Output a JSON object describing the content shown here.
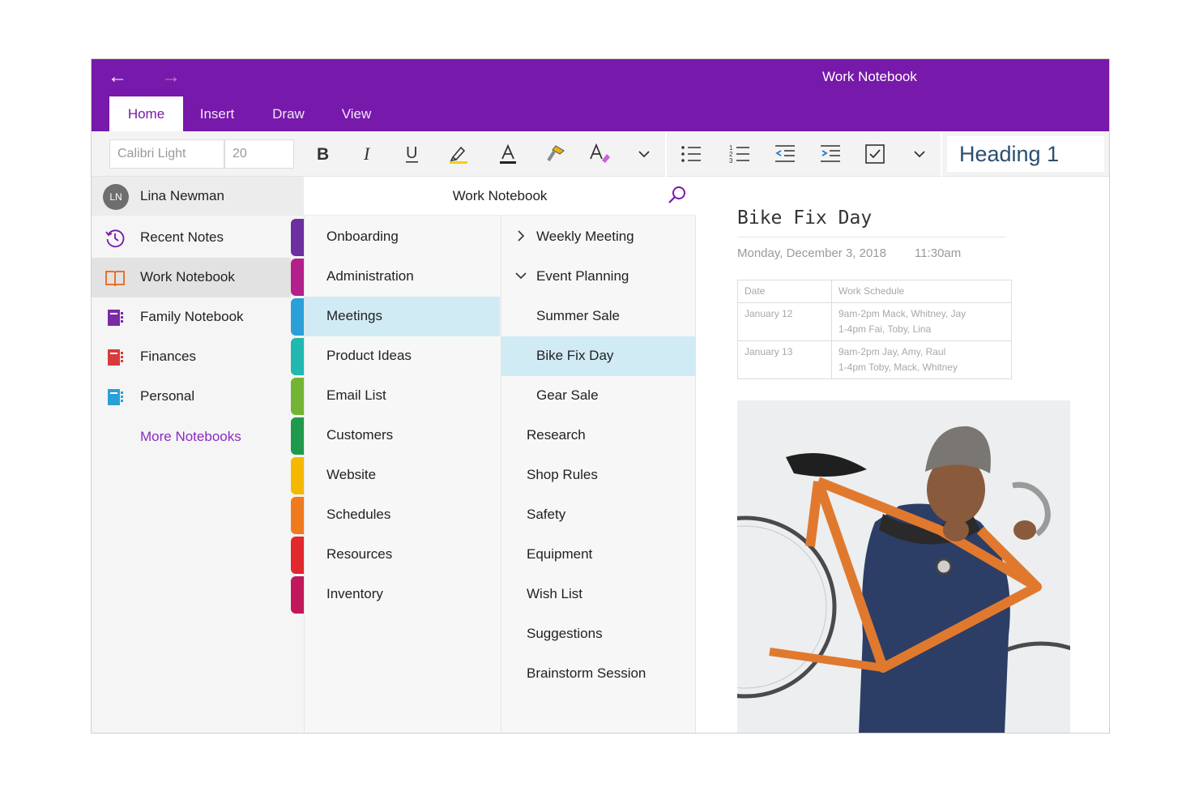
{
  "window": {
    "title": "Work Notebook"
  },
  "tabs": [
    {
      "label": "Home",
      "active": true
    },
    {
      "label": "Insert",
      "active": false
    },
    {
      "label": "Draw",
      "active": false
    },
    {
      "label": "View",
      "active": false
    }
  ],
  "ribbon": {
    "font_name": "Calibri Light",
    "font_size": "20",
    "style": "Heading 1",
    "buttons": [
      "bold-icon",
      "italic-icon",
      "underline-icon",
      "highlighter-icon",
      "font-color-icon",
      "format-painter-icon",
      "text-styles-icon",
      "chevron-down-icon",
      "bullet-list-icon",
      "numbered-list-icon",
      "outdent-icon",
      "indent-icon",
      "checkbox-icon",
      "chevron-down-icon"
    ]
  },
  "user": {
    "initials": "LN",
    "name": "Lina Newman"
  },
  "notebooks": [
    {
      "label": "Recent Notes",
      "icon": "clock-icon",
      "color": "#7719aa",
      "active": false
    },
    {
      "label": "Work Notebook",
      "icon": "book-open-icon",
      "color": "#e8722a",
      "active": true
    },
    {
      "label": "Family Notebook",
      "icon": "notebook-icon",
      "color": "#7b2ba6",
      "active": false
    },
    {
      "label": "Finances",
      "icon": "notebook-icon",
      "color": "#d83b3b",
      "active": false
    },
    {
      "label": "Personal",
      "icon": "notebook-icon",
      "color": "#2aa0d8",
      "active": false
    }
  ],
  "more_notebooks": "More Notebooks",
  "notebook_header": "Work Notebook",
  "sections": [
    {
      "label": "Onboarding",
      "color": "#6b2fa0",
      "active": false
    },
    {
      "label": "Administration",
      "color": "#b3208c",
      "active": false
    },
    {
      "label": "Meetings",
      "color": "#2a9fd8",
      "active": true
    },
    {
      "label": "Product Ideas",
      "color": "#21b8b0",
      "active": false
    },
    {
      "label": "Email List",
      "color": "#73b532",
      "active": false
    },
    {
      "label": "Customers",
      "color": "#1f9a4c",
      "active": false
    },
    {
      "label": "Website",
      "color": "#f5b800",
      "active": false
    },
    {
      "label": "Schedules",
      "color": "#f07a1e",
      "active": false
    },
    {
      "label": "Resources",
      "color": "#e0282d",
      "active": false
    },
    {
      "label": "Inventory",
      "color": "#c2185b",
      "active": false
    }
  ],
  "pages": [
    {
      "label": "Weekly Meeting",
      "level": 0,
      "chevron": "right",
      "active": false
    },
    {
      "label": "Event Planning",
      "level": 0,
      "chevron": "down",
      "active": false
    },
    {
      "label": "Summer Sale",
      "level": 1,
      "chevron": "",
      "active": false
    },
    {
      "label": "Bike Fix Day",
      "level": 1,
      "chevron": "",
      "active": true
    },
    {
      "label": "Gear Sale",
      "level": 1,
      "chevron": "",
      "active": false
    },
    {
      "label": "Research",
      "level": 0,
      "chevron": "",
      "active": false
    },
    {
      "label": "Shop Rules",
      "level": 0,
      "chevron": "",
      "active": false
    },
    {
      "label": "Safety",
      "level": 0,
      "chevron": "",
      "active": false
    },
    {
      "label": "Equipment",
      "level": 0,
      "chevron": "",
      "active": false
    },
    {
      "label": "Wish List",
      "level": 0,
      "chevron": "",
      "active": false
    },
    {
      "label": "Suggestions",
      "level": 0,
      "chevron": "",
      "active": false
    },
    {
      "label": "Brainstorm Session",
      "level": 0,
      "chevron": "",
      "active": false
    }
  ],
  "page": {
    "title": "Bike Fix Day",
    "date": "Monday, December 3, 2018",
    "time": "11:30am",
    "table": {
      "headers": [
        "Date",
        "Work Schedule"
      ],
      "rows": [
        {
          "date": "January 12",
          "line1": "9am-2pm Mack, Whitney, Jay",
          "line2": "1-4pm Fai, Toby, Lina"
        },
        {
          "date": "January 13",
          "line1": "9am-2pm Jay, Amy, Raul",
          "line2": "1-4pm Toby, Mack, Whitney"
        }
      ]
    }
  },
  "colors": {
    "accent": "#7719aa",
    "selection": "#d1ebf5",
    "link": "#8a2bc2"
  }
}
